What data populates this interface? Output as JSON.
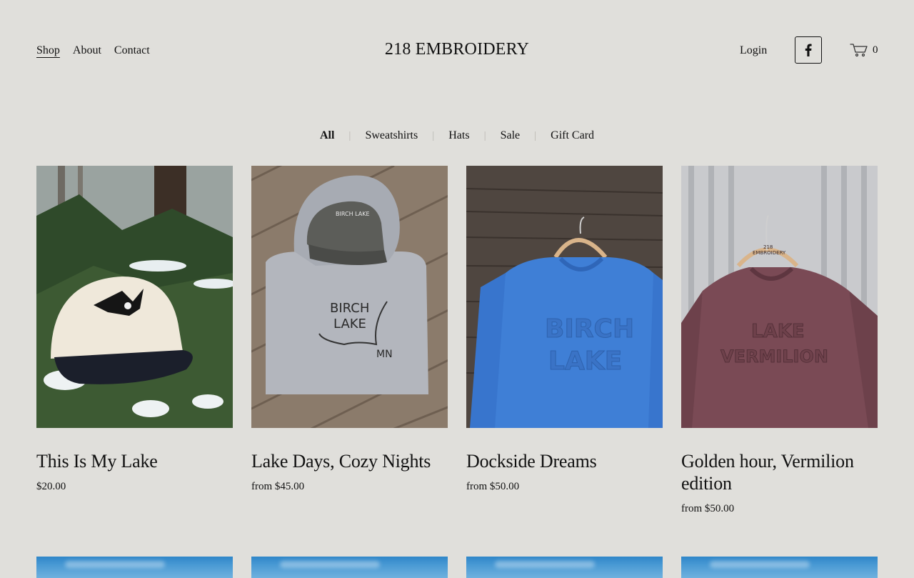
{
  "nav": {
    "links": [
      {
        "label": "Shop",
        "active": true
      },
      {
        "label": "About",
        "active": false
      },
      {
        "label": "Contact",
        "active": false
      }
    ]
  },
  "site_title": "218 EMBROIDERY",
  "header": {
    "login_label": "Login",
    "social_icon": "facebook-icon",
    "cart_icon": "cart-icon",
    "cart_count": "0"
  },
  "categories": [
    {
      "label": "All",
      "active": true
    },
    {
      "label": "Sweatshirts",
      "active": false
    },
    {
      "label": "Hats",
      "active": false
    },
    {
      "label": "Sale",
      "active": false
    },
    {
      "label": "Gift Card",
      "active": false
    }
  ],
  "products": [
    {
      "name": "This Is My Lake",
      "price": "$20.00",
      "image_text": []
    },
    {
      "name": "Lake Days, Cozy Nights",
      "price": "from $45.00",
      "image_text": [
        "BIRCH",
        "LAKE",
        "MN",
        "BIRCH LAKE"
      ]
    },
    {
      "name": "Dockside Dreams",
      "price": "from $50.00",
      "image_text": [
        "BIRCH",
        "LAKE"
      ]
    },
    {
      "name": "Golden hour, Vermilion edition",
      "price": "from $50.00",
      "image_text": [
        "LAKE",
        "VERMILION",
        "218",
        "EMBROIDERY"
      ]
    }
  ],
  "colors": {
    "background": "#e0dfdb",
    "text": "#111111"
  }
}
